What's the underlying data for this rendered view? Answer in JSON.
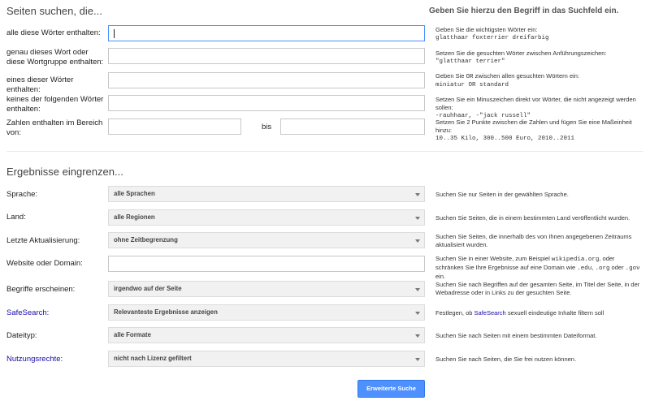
{
  "section1": {
    "title": "Seiten suchen, die...",
    "right_title": "Geben Sie hierzu den Begriff in das Suchfeld ein.",
    "rows": [
      {
        "label": "alle diese Wörter enthalten:",
        "hint_text": "Geben Sie die wichtigsten Wörter ein:",
        "hint_mono": "glatthaar foxterrier dreifarbig"
      },
      {
        "label": "genau dieses Wort oder diese Wortgruppe enthalten:",
        "hint_text": "Setzen Sie die gesuchten Wörter zwischen Anführungszeichen:",
        "hint_mono": "\"glatthaar terrier\""
      },
      {
        "label": "eines dieser Wörter enthalten:",
        "hint_text_a": "Geben Sie ",
        "hint_or": "OR",
        "hint_text_b": " zwischen allen gesuchten Wörtern ein:",
        "hint_mono": "miniatur OR standard"
      },
      {
        "label": "keines der folgenden Wörter enthalten:",
        "hint_text": "Setzen Sie ein Minuszeichen direkt vor Wörter, die nicht angezeigt werden sollen:",
        "hint_mono": "-rauhhaar, -\"jack russell\""
      },
      {
        "label": "Zahlen enthalten im Bereich von:",
        "bis": "bis",
        "hint_text": "Setzen Sie 2 Punkte zwischen die Zahlen und fügen Sie eine Maßeinheit hinzu:",
        "hint_mono": "10..35 Kilo, 300..500 Euro, 2010..2011"
      }
    ]
  },
  "section2": {
    "title": "Ergebnisse eingrenzen...",
    "rows": [
      {
        "label": "Sprache:",
        "value": "alle Sprachen",
        "hint": "Suchen Sie nur Seiten in der gewählten Sprache."
      },
      {
        "label": "Land:",
        "value": "alle Regionen",
        "hint": "Suchen Sie Seiten, die in einem bestimmten Land veröffentlicht wurden."
      },
      {
        "label": "Letzte Aktualisierung:",
        "value": "ohne Zeitbegrenzung",
        "hint": "Suchen Sie Seiten, die innerhalb des von Ihnen angegebenen Zeitraums aktualisiert wurden."
      },
      {
        "label": "Website oder Domain:",
        "value": "",
        "hint_a": "Suchen Sie in einer Website, zum Beispiel ",
        "hint_m1": "wikipedia.org",
        "hint_b": ", oder schränken Sie Ihre Ergebnisse auf eine Domain wie ",
        "hint_m2": ".edu",
        "hint_c": ", ",
        "hint_m3": ".org",
        "hint_d": " oder ",
        "hint_m4": ".gov",
        "hint_e": " ein."
      },
      {
        "label": "Begriffe erscheinen:",
        "value": "irgendwo auf der Seite",
        "hint": "Suchen Sie nach Begriffen auf der gesamten Seite, im Titel der Seite, in der Webadresse oder in Links zu der gesuchten Seite."
      },
      {
        "label": "SafeSearch:",
        "value": "Relevanteste Ergebnisse anzeigen",
        "hint_a": "Festlegen, ob ",
        "hint_link": "SafeSearch",
        "hint_b": " sexuell eindeutige Inhalte filtern soll"
      },
      {
        "label": "Dateityp:",
        "value": "alle Formate",
        "hint": "Suchen Sie nach Seiten mit einem bestimmten Dateiformat."
      },
      {
        "label": "Nutzungsrechte:",
        "value": "nicht nach Lizenz gefiltert",
        "hint": "Suchen Sie nach Seiten, die Sie frei nutzen können."
      }
    ]
  },
  "submit_label": "Erweiterte Suche",
  "colors": {
    "link": "#1a0dab",
    "button": "#4d90fe",
    "focus": "#4d90fe"
  }
}
